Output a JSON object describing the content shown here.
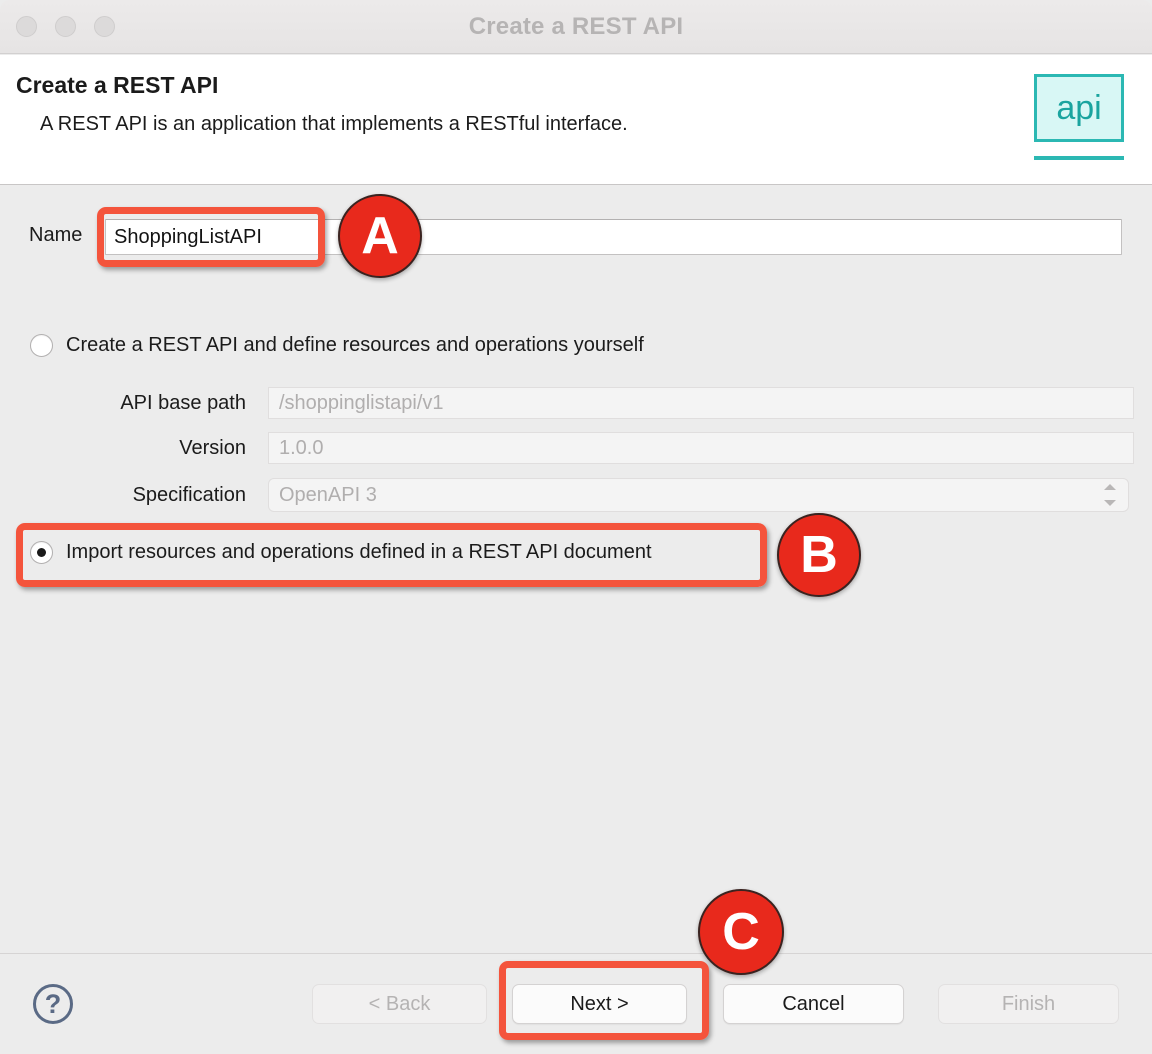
{
  "window": {
    "title": "Create a REST API",
    "traffic_lights": [
      "close",
      "minimize",
      "maximize"
    ]
  },
  "header": {
    "title": "Create a REST API",
    "subtitle": "A REST API is an application that implements a RESTful interface.",
    "badge_text": "api",
    "badge_border_color": "#2bb8b3",
    "badge_fill_color": "#d8f7f5"
  },
  "form": {
    "name_label": "Name",
    "name_value": "ShoppingListAPI",
    "option_create": {
      "label": "Create a REST API and define resources and operations yourself",
      "selected": false
    },
    "fields": [
      {
        "label": "API base path",
        "placeholder": "/shoppinglistapi/v1",
        "value": "",
        "enabled": false
      },
      {
        "label": "Version",
        "placeholder": "1.0.0",
        "value": "",
        "enabled": false
      }
    ],
    "specification": {
      "label": "Specification",
      "value": "OpenAPI 3",
      "enabled": false,
      "options": [
        "OpenAPI 3"
      ]
    },
    "option_import": {
      "label": "Import resources and operations defined in a REST API document",
      "selected": true
    }
  },
  "footer": {
    "help_glyph": "?",
    "buttons": [
      {
        "label": "< Back",
        "enabled": false
      },
      {
        "label": "Next >",
        "enabled": true
      },
      {
        "label": "Cancel",
        "enabled": true
      },
      {
        "label": "Finish",
        "enabled": false
      }
    ]
  },
  "annotations": {
    "color": "#f4543c",
    "badge_color": "#e8291c",
    "items": [
      {
        "letter": "A",
        "target": "name-input"
      },
      {
        "letter": "B",
        "target": "import-radio-option"
      },
      {
        "letter": "C",
        "target": "next-button"
      }
    ]
  }
}
